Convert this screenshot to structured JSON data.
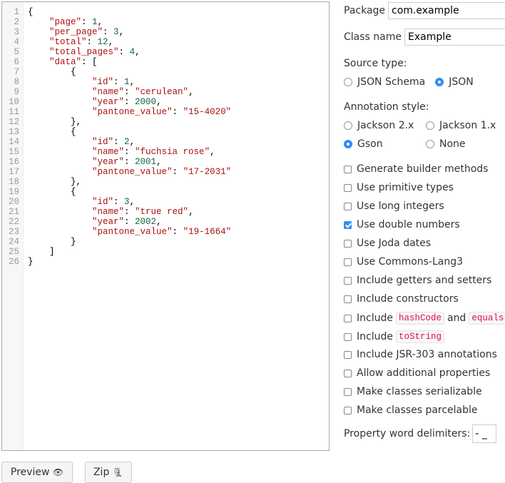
{
  "editor": {
    "lines": [
      [
        [
          "p",
          "{"
        ]
      ],
      [
        [
          "p",
          "    "
        ],
        [
          "k",
          "\"page\""
        ],
        [
          "p",
          ": "
        ],
        [
          "n",
          "1"
        ],
        [
          "p",
          ","
        ]
      ],
      [
        [
          "p",
          "    "
        ],
        [
          "k",
          "\"per_page\""
        ],
        [
          "p",
          ": "
        ],
        [
          "n",
          "3"
        ],
        [
          "p",
          ","
        ]
      ],
      [
        [
          "p",
          "    "
        ],
        [
          "k",
          "\"total\""
        ],
        [
          "p",
          ": "
        ],
        [
          "n",
          "12"
        ],
        [
          "p",
          ","
        ]
      ],
      [
        [
          "p",
          "    "
        ],
        [
          "k",
          "\"total_pages\""
        ],
        [
          "p",
          ": "
        ],
        [
          "n",
          "4"
        ],
        [
          "p",
          ","
        ]
      ],
      [
        [
          "p",
          "    "
        ],
        [
          "k",
          "\"data\""
        ],
        [
          "p",
          ": ["
        ]
      ],
      [
        [
          "p",
          "        {"
        ]
      ],
      [
        [
          "p",
          "            "
        ],
        [
          "k",
          "\"id\""
        ],
        [
          "p",
          ": "
        ],
        [
          "n",
          "1"
        ],
        [
          "p",
          ","
        ]
      ],
      [
        [
          "p",
          "            "
        ],
        [
          "k",
          "\"name\""
        ],
        [
          "p",
          ": "
        ],
        [
          "s",
          "\"cerulean\""
        ],
        [
          "p",
          ","
        ]
      ],
      [
        [
          "p",
          "            "
        ],
        [
          "k",
          "\"year\""
        ],
        [
          "p",
          ": "
        ],
        [
          "n",
          "2000"
        ],
        [
          "p",
          ","
        ]
      ],
      [
        [
          "p",
          "            "
        ],
        [
          "k",
          "\"pantone_value\""
        ],
        [
          "p",
          ": "
        ],
        [
          "s",
          "\"15-4020\""
        ]
      ],
      [
        [
          "p",
          "        },"
        ]
      ],
      [
        [
          "p",
          "        {"
        ]
      ],
      [
        [
          "p",
          "            "
        ],
        [
          "k",
          "\"id\""
        ],
        [
          "p",
          ": "
        ],
        [
          "n",
          "2"
        ],
        [
          "p",
          ","
        ]
      ],
      [
        [
          "p",
          "            "
        ],
        [
          "k",
          "\"name\""
        ],
        [
          "p",
          ": "
        ],
        [
          "s",
          "\"fuchsia rose\""
        ],
        [
          "p",
          ","
        ]
      ],
      [
        [
          "p",
          "            "
        ],
        [
          "k",
          "\"year\""
        ],
        [
          "p",
          ": "
        ],
        [
          "n",
          "2001"
        ],
        [
          "p",
          ","
        ]
      ],
      [
        [
          "p",
          "            "
        ],
        [
          "k",
          "\"pantone_value\""
        ],
        [
          "p",
          ": "
        ],
        [
          "s",
          "\"17-2031\""
        ]
      ],
      [
        [
          "p",
          "        },"
        ]
      ],
      [
        [
          "p",
          "        {"
        ]
      ],
      [
        [
          "p",
          "            "
        ],
        [
          "k",
          "\"id\""
        ],
        [
          "p",
          ": "
        ],
        [
          "n",
          "3"
        ],
        [
          "p",
          ","
        ]
      ],
      [
        [
          "p",
          "            "
        ],
        [
          "k",
          "\"name\""
        ],
        [
          "p",
          ": "
        ],
        [
          "s",
          "\"true red\""
        ],
        [
          "p",
          ","
        ]
      ],
      [
        [
          "p",
          "            "
        ],
        [
          "k",
          "\"year\""
        ],
        [
          "p",
          ": "
        ],
        [
          "n",
          "2002"
        ],
        [
          "p",
          ","
        ]
      ],
      [
        [
          "p",
          "            "
        ],
        [
          "k",
          "\"pantone_value\""
        ],
        [
          "p",
          ": "
        ],
        [
          "s",
          "\"19-1664\""
        ]
      ],
      [
        [
          "p",
          "        }"
        ]
      ],
      [
        [
          "p",
          "    ]"
        ]
      ],
      [
        [
          "p",
          "}"
        ]
      ]
    ]
  },
  "form": {
    "package_label": "Package",
    "package_value": "com.example",
    "class_label": "Class name",
    "class_value": "Example",
    "source_type_label": "Source type:",
    "source_json_schema": "JSON Schema",
    "source_json": "JSON",
    "annotation_label": "Annotation style:",
    "ann_jackson2": "Jackson 2.x",
    "ann_jackson1": "Jackson 1.x",
    "ann_gson": "Gson",
    "ann_none": "None",
    "options": [
      {
        "label": "Generate builder methods",
        "checked": false
      },
      {
        "label": "Use primitive types",
        "checked": false
      },
      {
        "label": "Use long integers",
        "checked": false
      },
      {
        "label": "Use double numbers",
        "checked": true
      },
      {
        "label": "Use Joda dates",
        "checked": false
      },
      {
        "label": "Use Commons-Lang3",
        "checked": false
      },
      {
        "label": "Include getters and setters",
        "checked": false
      },
      {
        "label": "Include constructors",
        "checked": false
      },
      {
        "label": "Include",
        "code1": "hashCode",
        "mid": "and",
        "code2": "equals",
        "checked": false
      },
      {
        "label": "Include",
        "code1": "toString",
        "checked": false
      },
      {
        "label": "Include JSR-303 annotations",
        "checked": false
      },
      {
        "label": "Allow additional properties",
        "checked": false
      },
      {
        "label": "Make classes serializable",
        "checked": false
      },
      {
        "label": "Make classes parcelable",
        "checked": false
      }
    ],
    "delimiters_label": "Property word delimiters:",
    "delimiters_value": "- _"
  },
  "buttons": {
    "preview": "Preview",
    "preview_icon": "👁",
    "zip": "Zip",
    "zip_icon": "🗜"
  }
}
